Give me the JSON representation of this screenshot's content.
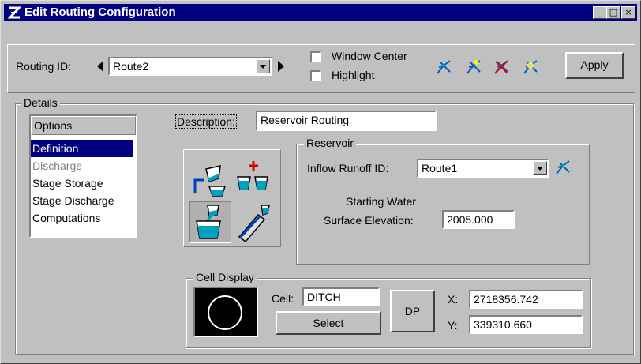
{
  "window": {
    "title": "Edit Routing Configuration"
  },
  "titlebar_buttons": {
    "minimize": "_",
    "maximize": "□",
    "close": "×"
  },
  "routing": {
    "label": "Routing ID:",
    "value": "Route2",
    "window_center_label": "Window Center",
    "highlight_label": "Highlight",
    "window_center_checked": false,
    "highlight_checked": false,
    "apply_label": "Apply"
  },
  "details": {
    "label": "Details",
    "options_header": "Options",
    "items": [
      {
        "label": "Definition",
        "state": "selected"
      },
      {
        "label": "Discharge",
        "state": "disabled"
      },
      {
        "label": "Stage Storage",
        "state": "normal"
      },
      {
        "label": "Stage Discharge",
        "state": "normal"
      },
      {
        "label": "Computations",
        "state": "normal"
      }
    ]
  },
  "description": {
    "label": "Description:",
    "value": "Reservoir Routing"
  },
  "reservoir": {
    "label": "Reservoir",
    "inflow_label": "Inflow Runoff ID:",
    "inflow_value": "Route1",
    "starting_line1": "Starting Water",
    "starting_line2": "Surface Elevation:",
    "elevation": "2005.000"
  },
  "cell_display": {
    "label": "Cell Display",
    "cell_label": "Cell:",
    "cell_value": "DITCH",
    "select_label": "Select",
    "dp_label": "DP",
    "x_label": "X:",
    "x_value": "2718356.742",
    "y_label": "Y:",
    "y_value": "339310.660"
  },
  "colors": {
    "title_bg": "#000080",
    "selection": "#000080",
    "face": "#c0c0c0",
    "disabled_text": "#808080"
  }
}
